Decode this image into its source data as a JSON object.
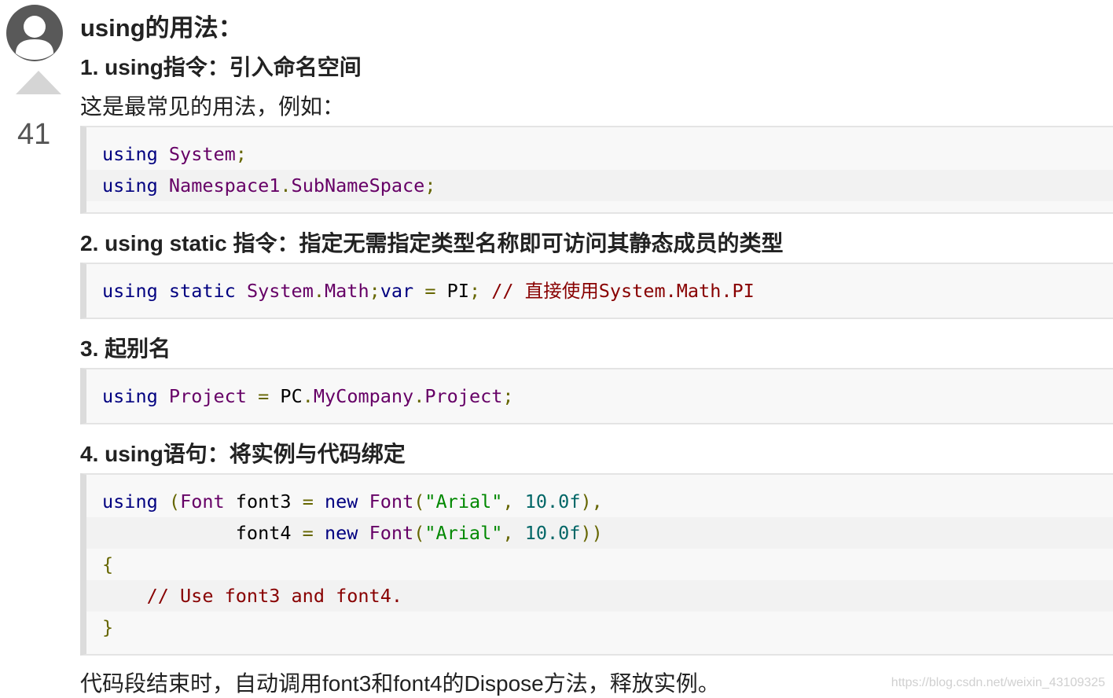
{
  "vote": {
    "count": "41"
  },
  "article": {
    "title": "using的用法：",
    "h1": "1. using指令：引入命名空间",
    "p1": "这是最常见的用法，例如：",
    "h2": "2. using static 指令：指定无需指定类型名称即可访问其静态成员的类型",
    "h3": "3. 起别名",
    "h4": "4. using语句：将实例与代码绑定",
    "p_end": "代码段结束时，自动调用font3和font4的Dispose方法，释放实例。"
  },
  "code1": {
    "l1": {
      "kw": "using",
      "sp": " ",
      "ty": "System",
      "pu": ";"
    },
    "l2": {
      "kw": "using",
      "sp": " ",
      "ty1": "Namespace1",
      "pu1": ".",
      "ty2": "SubNameSpace",
      "pu2": ";"
    }
  },
  "code2": {
    "l1": {
      "kw1": "using",
      "sp1": " ",
      "kw2": "static",
      "sp2": " ",
      "ty1": "System",
      "pu1": ".",
      "ty2": "Math",
      "pu2": ";",
      "kw3": "var",
      "sp3": " ",
      "pu3": "=",
      "sp4": " ",
      "pl": "PI",
      "pu4": ";",
      "sp5": " ",
      "co": "// 直接使用System.Math.PI"
    }
  },
  "code3": {
    "l1": {
      "kw": "using",
      "sp1": " ",
      "ty1": "Project",
      "sp2": " ",
      "pu1": "=",
      "sp3": " ",
      "pl": "PC",
      "pu2": ".",
      "ty2": "MyCompany",
      "pu3": ".",
      "ty3": "Project",
      "pu4": ";"
    }
  },
  "code4": {
    "l1": {
      "kw": "using",
      "sp1": " ",
      "pu1": "(",
      "ty1": "Font",
      "pl1": " font3 ",
      "pu2": "=",
      "sp2": " ",
      "kw2": "new",
      "sp3": " ",
      "ty2": "Font",
      "pu3": "(",
      "st": "\"Arial\"",
      "pu4": ",",
      "sp4": " ",
      "nu": "10.0f",
      "pu5": "),"
    },
    "l2": {
      "indent": "            ",
      "pl1": "font4 ",
      "pu1": "=",
      "sp1": " ",
      "kw": "new",
      "sp2": " ",
      "ty": "Font",
      "pu2": "(",
      "st": "\"Arial\"",
      "pu3": ",",
      "sp3": " ",
      "nu": "10.0f",
      "pu4": "))"
    },
    "l3": {
      "pu": "{"
    },
    "l4": {
      "indent": "    ",
      "co": "// Use font3 and font4."
    },
    "l5": {
      "pu": "}"
    }
  },
  "watermark": "https://blog.csdn.net/weixin_43109325"
}
